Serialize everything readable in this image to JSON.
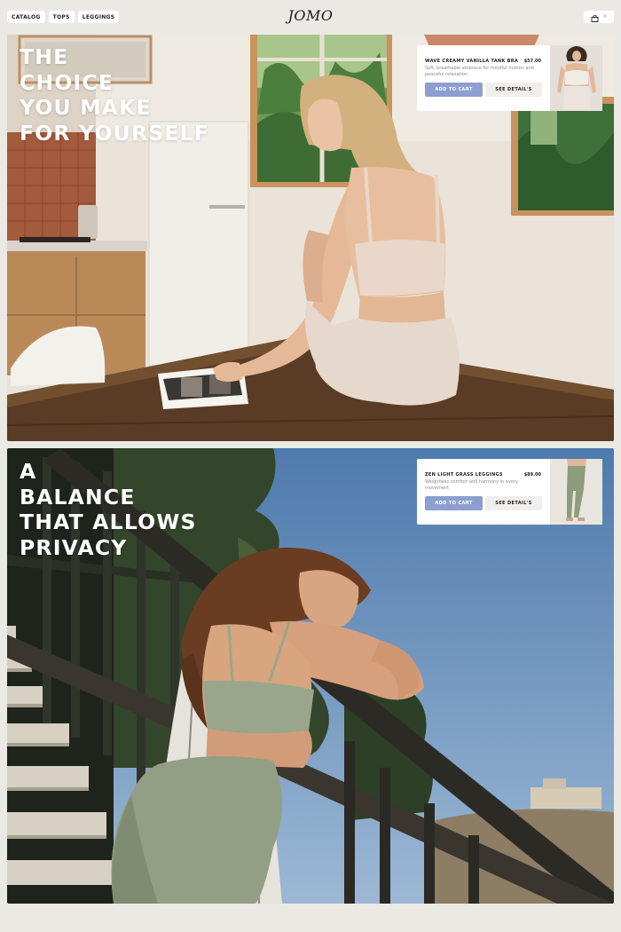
{
  "header": {
    "nav": [
      "CATALOG",
      "TOPS",
      "LEGGINGS"
    ],
    "logo": "JOMO",
    "cart_icon": "bag-icon",
    "cart_count": "0"
  },
  "sections": [
    {
      "headline": [
        "THE",
        "CHOICE",
        "YOU MAKE",
        "FOR YOURSELF"
      ],
      "product": {
        "name": "WAVE CREAMY VANILLA TANK BRA",
        "price": "$57.00",
        "description": "Soft, breathable embrace for mindful motion and peaceful relaxation",
        "add_to_cart": "ADD TO CART",
        "see_details": "SEE DETAIL'S"
      }
    },
    {
      "headline": [
        "A",
        "BALANCE",
        "THAT ALLOWS",
        "PRIVACY"
      ],
      "product": {
        "name": "ZEN LIGHT GRASS LEGGINGS",
        "price": "$89.00",
        "description": "Weightless comfort and harmony in every movement",
        "add_to_cart": "ADD TO CART",
        "see_details": "SEE DETAIL'S"
      }
    }
  ],
  "colors": {
    "page_bg": "#ebe9e4",
    "accent_button": "#8d9fd0",
    "vanilla": "#e6d3c6",
    "sage": "#97a68b",
    "sky": "#5f86b5"
  }
}
